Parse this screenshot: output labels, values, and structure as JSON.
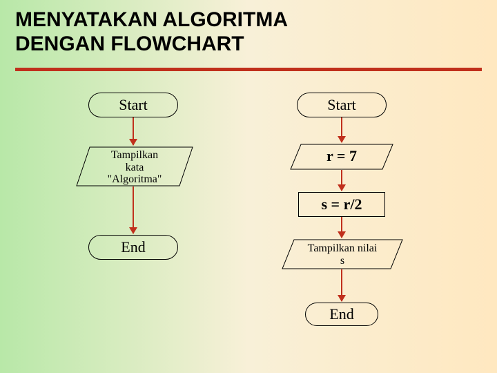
{
  "title_line1": "MENYATAKAN ALGORITMA",
  "title_line2": "DENGAN FLOWCHART",
  "flowchart_left": {
    "start": "Start",
    "io": "Tampilkan\nkata\n\"Algoritma\"",
    "end": "End"
  },
  "flowchart_right": {
    "start": "Start",
    "input": "r = 7",
    "process": "s = r/2",
    "output": "Tampilkan nilai\ns",
    "end": "End"
  },
  "chart_data": [
    {
      "type": "flowchart",
      "title": "Left flowchart",
      "nodes": [
        {
          "id": "L1",
          "shape": "terminator",
          "label": "Start"
        },
        {
          "id": "L2",
          "shape": "io",
          "label": "Tampilkan kata \"Algoritma\""
        },
        {
          "id": "L3",
          "shape": "terminator",
          "label": "End"
        }
      ],
      "edges": [
        {
          "from": "L1",
          "to": "L2"
        },
        {
          "from": "L2",
          "to": "L3"
        }
      ]
    },
    {
      "type": "flowchart",
      "title": "Right flowchart",
      "nodes": [
        {
          "id": "R1",
          "shape": "terminator",
          "label": "Start"
        },
        {
          "id": "R2",
          "shape": "io",
          "label": "r = 7"
        },
        {
          "id": "R3",
          "shape": "process",
          "label": "s = r/2"
        },
        {
          "id": "R4",
          "shape": "io",
          "label": "Tampilkan nilai s"
        },
        {
          "id": "R5",
          "shape": "terminator",
          "label": "End"
        }
      ],
      "edges": [
        {
          "from": "R1",
          "to": "R2"
        },
        {
          "from": "R2",
          "to": "R3"
        },
        {
          "from": "R3",
          "to": "R4"
        },
        {
          "from": "R4",
          "to": "R5"
        }
      ]
    }
  ]
}
